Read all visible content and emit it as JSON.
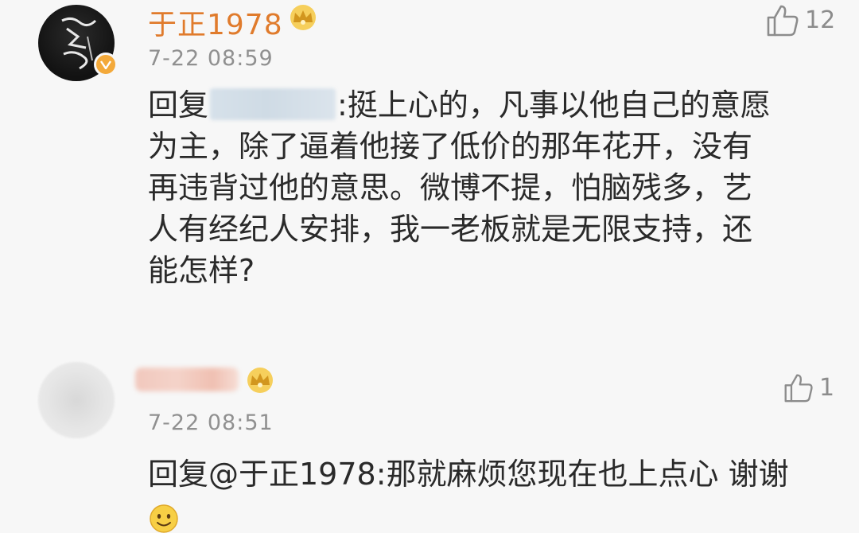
{
  "comments": [
    {
      "username": "于正1978",
      "timestamp": "7-22 08:59",
      "likes": "12",
      "reply_prefix": "回复",
      "mention_blurred": true,
      "lines": [
        ":挺上心的，凡事以他自己的意愿",
        "为主，除了逼着他接了低价的那年花开，没有",
        "再违背过他的意思。微博不提，怕脑残多，艺",
        "人有经纪人安排，我一老板就是无限支持，还",
        "能怎样?"
      ],
      "badges": [
        "crown-icon",
        "verified-badge-icon"
      ]
    },
    {
      "username_blurred": true,
      "timestamp": "7-22 08:51",
      "likes": "1",
      "reply_text": "回复@于正1978:那就麻烦您现在也上点心 谢谢",
      "trailing_icon": "smiley-emoji-icon",
      "badges": [
        "crown-icon"
      ]
    }
  ],
  "colors": {
    "username": "#e07b2c",
    "timestamp": "#909090",
    "text": "#2a2a2a",
    "background": "#f7f7f7",
    "like": "#8c8c8c"
  }
}
